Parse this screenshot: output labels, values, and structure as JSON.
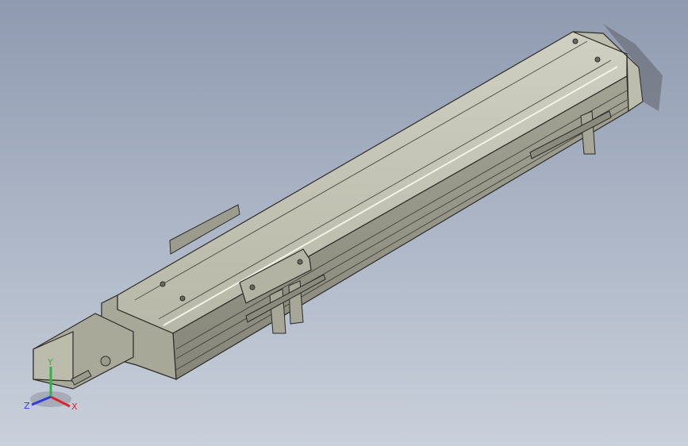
{
  "viewport": {
    "background_top": "#8f9ab0",
    "background_bottom": "#c9d0db",
    "model_color": "#b9b9a9",
    "edge_color": "#2b2b28"
  },
  "triad": {
    "x_label": "X",
    "y_label": "Y",
    "z_label": "Z",
    "x_color": "#d8262b",
    "y_color": "#2fb24a",
    "z_color": "#2b3fd6"
  }
}
